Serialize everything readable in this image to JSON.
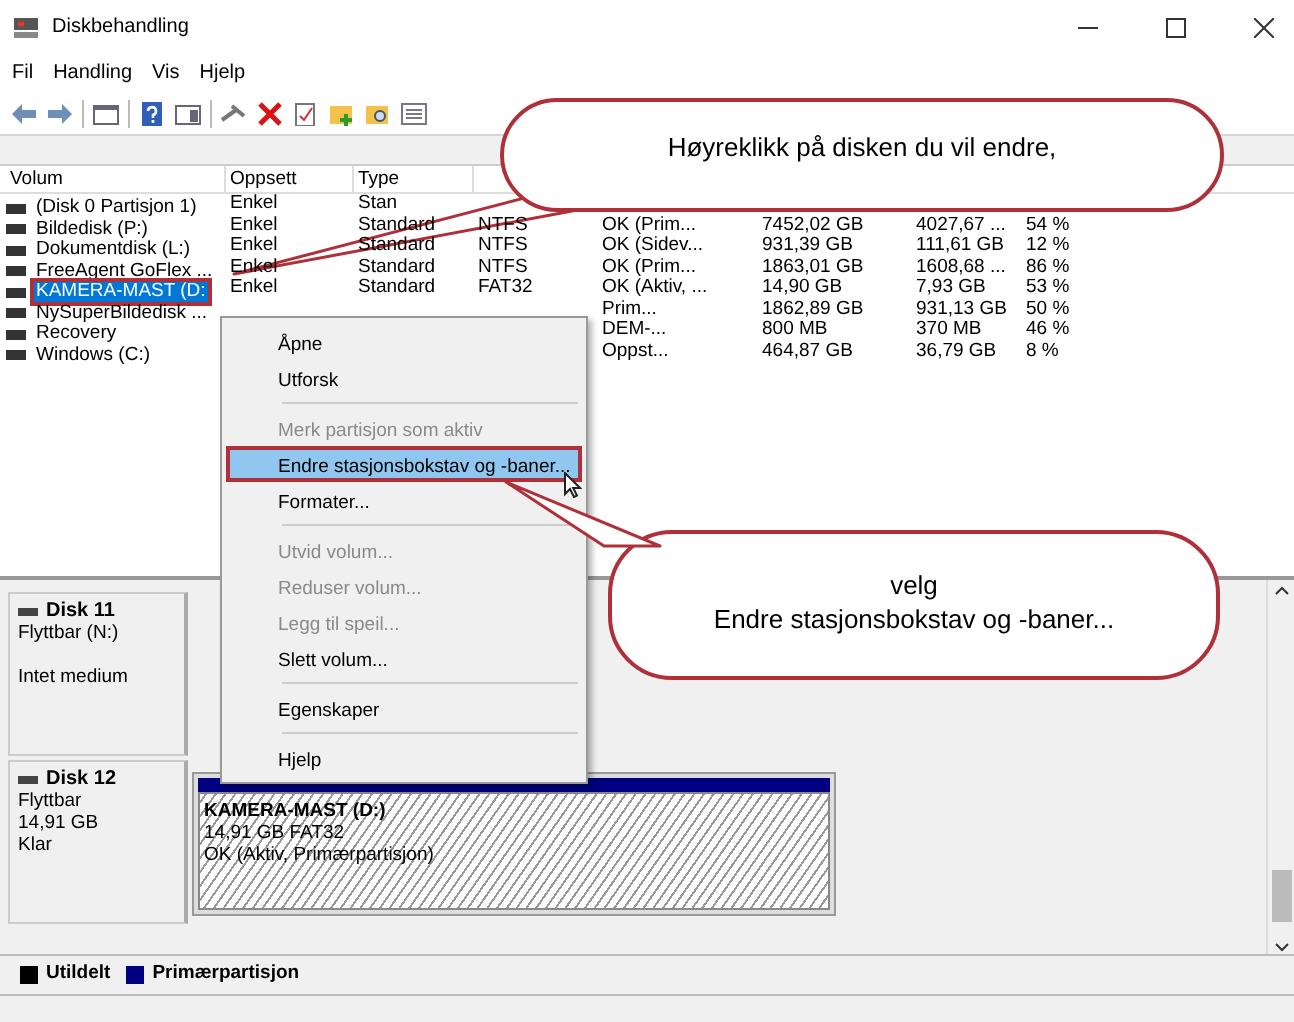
{
  "window": {
    "title": "Diskbehandling"
  },
  "menu_bar": [
    "Fil",
    "Handling",
    "Vis",
    "Hjelp"
  ],
  "table": {
    "columns": [
      "Volum",
      "Oppsett",
      "Type"
    ],
    "rows": [
      {
        "selected": false,
        "highlighted": false,
        "cells": [
          "(Disk 0 Partisjon 1)",
          "Enkel",
          "Stan",
          null,
          null,
          null,
          null,
          null
        ]
      },
      {
        "selected": false,
        "highlighted": false,
        "cells": [
          "Bildedisk (P:)",
          "Enkel",
          "Standard",
          "NTFS",
          "OK (Prim...",
          "7452,02 GB",
          "4027,67 ...",
          "54 %"
        ]
      },
      {
        "selected": false,
        "highlighted": false,
        "cells": [
          "Dokumentdisk (L:)",
          "Enkel",
          "Standard",
          "NTFS",
          "OK (Sidev...",
          "931,39 GB",
          "111,61 GB",
          "12 %"
        ]
      },
      {
        "selected": false,
        "highlighted": false,
        "cells": [
          "FreeAgent GoFlex ...",
          "Enkel",
          "Standard",
          "NTFS",
          "OK (Prim...",
          "1863,01 GB",
          "1608,68 ...",
          "86 %"
        ]
      },
      {
        "selected": true,
        "highlighted": true,
        "cells": [
          "KAMERA-MAST (D:",
          "Enkel",
          "Standard",
          "FAT32",
          "OK (Aktiv, ...",
          "14,90 GB",
          "7,93 GB",
          "53 %"
        ]
      },
      {
        "selected": false,
        "highlighted": false,
        "cells": [
          "NySuperBildedisk ...",
          null,
          null,
          null,
          "Prim...",
          "1862,89 GB",
          "931,13 GB",
          "50 %"
        ]
      },
      {
        "selected": false,
        "highlighted": false,
        "cells": [
          "Recovery",
          null,
          null,
          null,
          "DEM-...",
          "800 MB",
          "370 MB",
          "46 %"
        ]
      },
      {
        "selected": false,
        "highlighted": false,
        "cells": [
          "Windows (C:)",
          null,
          null,
          null,
          "Oppst...",
          "464,87 GB",
          "36,79 GB",
          "8 %"
        ]
      }
    ]
  },
  "context_menu": {
    "items": [
      {
        "kind": "item",
        "label": "Åpne",
        "disabled": false,
        "selected": false,
        "highlighted": false
      },
      {
        "kind": "item",
        "label": "Utforsk",
        "disabled": false,
        "selected": false,
        "highlighted": false
      },
      {
        "kind": "separator"
      },
      {
        "kind": "item",
        "label": "Merk partisjon som aktiv",
        "disabled": true,
        "selected": false,
        "highlighted": false
      },
      {
        "kind": "item",
        "label": "Endre stasjonsbokstav og -baner...",
        "disabled": false,
        "selected": true,
        "highlighted": true
      },
      {
        "kind": "item",
        "label": "Formater...",
        "disabled": false,
        "selected": false,
        "highlighted": false
      },
      {
        "kind": "separator"
      },
      {
        "kind": "item",
        "label": "Utvid volum...",
        "disabled": true,
        "selected": false,
        "highlighted": false
      },
      {
        "kind": "item",
        "label": "Reduser volum...",
        "disabled": true,
        "selected": false,
        "highlighted": false
      },
      {
        "kind": "item",
        "label": "Legg til speil...",
        "disabled": true,
        "selected": false,
        "highlighted": false
      },
      {
        "kind": "item",
        "label": "Slett volum...",
        "disabled": false,
        "selected": false,
        "highlighted": false
      },
      {
        "kind": "separator"
      },
      {
        "kind": "item",
        "label": "Egenskaper",
        "disabled": false,
        "selected": false,
        "highlighted": false
      },
      {
        "kind": "separator"
      },
      {
        "kind": "item",
        "label": "Hjelp",
        "disabled": false,
        "selected": false,
        "highlighted": false
      }
    ]
  },
  "callouts": [
    "Høyreklikk på disken du vil endre,",
    "velg\nEndre stasjonsbokstav og -baner..."
  ],
  "disks": [
    {
      "name": "Disk 11",
      "info": [
        "Flyttbar (N:)"
      ],
      "media_status": "Intet medium"
    },
    {
      "name": "Disk 12",
      "info": [
        "Flyttbar",
        "14,91 GB",
        "Klar"
      ],
      "partition": {
        "name": "KAMERA-MAST  (D:)",
        "size": "14,91 GB FAT32",
        "status": "OK (Aktiv, Primærpartisjon)"
      }
    }
  ],
  "legend": [
    {
      "label": "Utildelt",
      "color": "#000000"
    },
    {
      "label": "Primærpartisjon",
      "color": "#000080"
    }
  ]
}
